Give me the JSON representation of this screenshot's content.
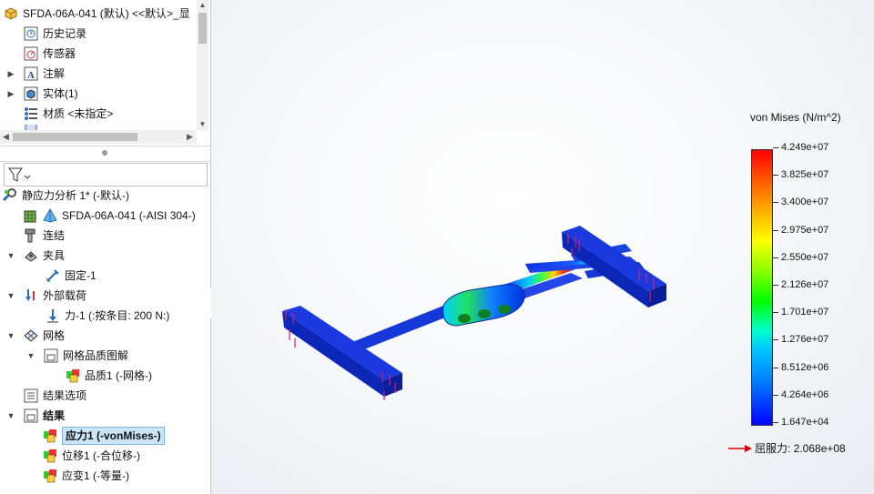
{
  "top_tree": {
    "part": "SFDA-06A-041 (默认) <<默认>_显",
    "items": [
      {
        "label": "历史记录",
        "icon": "history-folder-icon"
      },
      {
        "label": "传感器",
        "icon": "sensor-icon"
      },
      {
        "label": "注解",
        "icon": "annotation-icon"
      },
      {
        "label": "实体(1)",
        "icon": "solid-body-icon"
      },
      {
        "label": "材质 <未指定>",
        "icon": "material-icon"
      },
      {
        "label": "...",
        "icon": "plane-icon"
      }
    ]
  },
  "sim_tree": {
    "study": "静应力分析 1* (-默认-)",
    "part": "SFDA-06A-041 (-AISI 304-)",
    "connections": "连结",
    "fixtures": "夹具",
    "fixed": "固定-1",
    "external_loads": "外部载荷",
    "force": "力-1 (:按条目: 200 N:)",
    "mesh": "网格",
    "mesh_quality_plot": "网格品质图解",
    "quality": "品质1 (-网格-)",
    "result_options": "结果选项",
    "results": "结果",
    "stress": "应力1 (-vonMises-)",
    "displacement": "位移1 (-合位移-)",
    "strain": "应变1 (-等量-)"
  },
  "legend": {
    "title": "von Mises (N/m^2)",
    "labels": [
      "4.249e+07",
      "3.825e+07",
      "3.400e+07",
      "2.975e+07",
      "2.550e+07",
      "2.126e+07",
      "1.701e+07",
      "1.276e+07",
      "8.512e+06",
      "4.264e+06",
      "1.647e+04"
    ],
    "yield_label": "屈服力: 2.068e+08",
    "colors": {
      "max": "#ff0000",
      "min": "#0000ff",
      "arrow": "#d00000"
    }
  }
}
